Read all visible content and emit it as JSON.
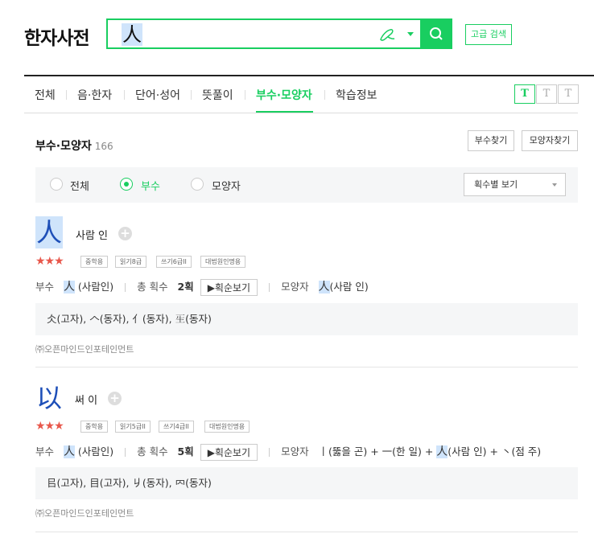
{
  "header": {
    "logo": "한자사전",
    "search_value": "人",
    "advanced_label": "고급 검색",
    "icons": [
      "handwriting-pen-icon",
      "dropdown-caret-icon",
      "search-icon"
    ]
  },
  "tabs": [
    {
      "label": "전체"
    },
    {
      "label": "음·한자"
    },
    {
      "label": "단어·성어"
    },
    {
      "label": "뜻풀이"
    },
    {
      "label": "부수·모양자",
      "active": true
    },
    {
      "label": "학습정보"
    }
  ],
  "font_size_buttons": [
    "T",
    "T",
    "T"
  ],
  "section": {
    "title": "부수·모양자",
    "count": "166",
    "btn_radical": "부수찾기",
    "btn_shape": "모양자찾기"
  },
  "filter": {
    "options": [
      "전체",
      "부수",
      "모양자"
    ],
    "selected": "부수",
    "sort_label": "획수별 보기"
  },
  "entries": [
    {
      "hanja": "人",
      "reading": "사람 인",
      "stars": "★★★",
      "badges": [
        "중학용",
        "읽기8급",
        "쓰기6급II",
        "대법원인명용"
      ],
      "radical_label": "부수",
      "radical_char": "人",
      "radical_text": " (사람인)",
      "strokes_label": "총 획수",
      "strokes": "2획",
      "stroke_btn": "▶획순보기",
      "shape_label": "모양자",
      "shape_char": "人",
      "shape_text": "(사람 인)",
      "variants": "仌(고자), 𠆢(동자), 亻(동자), 𤯔(동자)",
      "source": "㈜오픈마인드인포테인먼트"
    },
    {
      "hanja": "以",
      "reading": "써 이",
      "stars": "★★★",
      "badges": [
        "중학용",
        "읽기5급II",
        "쓰기4급II",
        "대법원인명용"
      ],
      "radical_label": "부수",
      "radical_char": "人",
      "radical_text": " (사람인)",
      "strokes_label": "총 획수",
      "strokes": "5획",
      "stroke_btn": "▶획순보기",
      "shape_label": "모양자",
      "shape_pre": "丨(뚫을 곤) + 一(한 일) + ",
      "shape_char": "人",
      "shape_post": "(사람 인) + 丶(점 주)",
      "variants": "㠯(고자), 目(고자), 𠂈(동자), 𠔿(동자)",
      "source": "㈜오픈마인드인포테인먼트"
    }
  ]
}
